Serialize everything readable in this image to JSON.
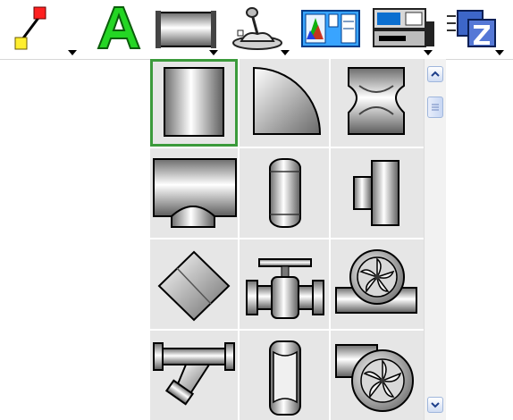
{
  "toolbar": {
    "buttons": [
      {
        "name": "line-tool",
        "icon": "line-with-handles-icon",
        "has_dropdown": true
      },
      {
        "name": "text-tool",
        "icon": "text-a-icon",
        "has_dropdown": false
      },
      {
        "name": "pipe-tool",
        "icon": "pipe-icon",
        "has_dropdown": true
      },
      {
        "name": "valve-joystick-tool",
        "icon": "joystick-icon",
        "has_dropdown": true
      },
      {
        "name": "trend-display-tool",
        "icon": "chart-panel-icon",
        "has_dropdown": false
      },
      {
        "name": "device-tool",
        "icon": "device-panel-icon",
        "has_dropdown": true
      },
      {
        "name": "window-group-tool",
        "icon": "stacked-windows-z-icon",
        "has_dropdown": true
      }
    ]
  },
  "palette": {
    "selected": "straight-pipe",
    "items": [
      {
        "name": "straight-pipe",
        "icon": "straight-pipe-icon"
      },
      {
        "name": "pipe-elbow",
        "icon": "pipe-elbow-icon"
      },
      {
        "name": "pipe-cross",
        "icon": "pipe-cross-icon"
      },
      {
        "name": "pipe-tee",
        "icon": "pipe-tee-icon"
      },
      {
        "name": "vertical-tank",
        "icon": "vertical-tank-icon"
      },
      {
        "name": "pipe-reducer",
        "icon": "pipe-reducer-icon"
      },
      {
        "name": "diamond-junction",
        "icon": "diamond-junction-icon"
      },
      {
        "name": "gate-valve",
        "icon": "gate-valve-icon"
      },
      {
        "name": "inline-fan",
        "icon": "inline-fan-icon"
      },
      {
        "name": "y-strainer",
        "icon": "y-strainer-icon"
      },
      {
        "name": "pipe-coupling",
        "icon": "pipe-coupling-icon"
      },
      {
        "name": "blower-fan",
        "icon": "blower-fan-icon"
      }
    ]
  },
  "colors": {
    "selection": "#3b9a3b",
    "palette_bg": "#e6e6e6",
    "metal_light": "#ffffff",
    "metal_dark": "#7a7a7a"
  }
}
